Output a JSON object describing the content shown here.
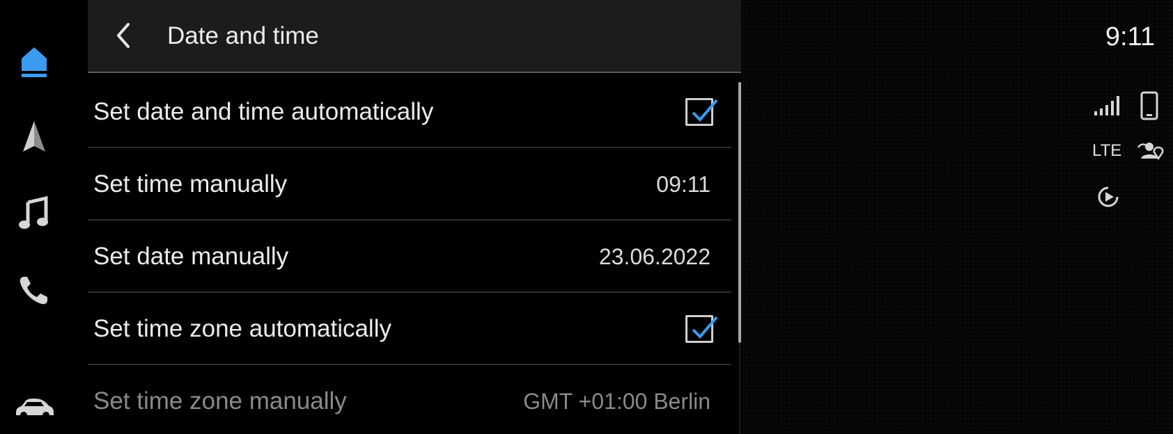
{
  "header": {
    "title": "Date and time"
  },
  "rail": {
    "items": [
      {
        "icon": "home-icon",
        "active": true
      },
      {
        "icon": "navigation-icon",
        "active": false
      },
      {
        "icon": "music-icon",
        "active": false
      },
      {
        "icon": "phone-icon",
        "active": false
      },
      {
        "icon": "car-icon",
        "active": false
      }
    ]
  },
  "settings": {
    "rows": [
      {
        "label": "Set date and time automatically",
        "type": "checkbox",
        "checked": true
      },
      {
        "label": "Set time manually",
        "type": "value",
        "value": "09:11"
      },
      {
        "label": "Set date manually",
        "type": "value",
        "value": "23.06.2022"
      },
      {
        "label": "Set time zone automatically",
        "type": "checkbox",
        "checked": true
      },
      {
        "label": "Set time zone manually",
        "type": "value",
        "value": "GMT +01:00 Berlin",
        "disabled": true
      }
    ]
  },
  "status": {
    "time": "9:11",
    "network": "LTE",
    "icons": [
      "signal-bars-icon",
      "phone-device-icon",
      "location-sharing-icon",
      "media-play-icon"
    ]
  },
  "colors": {
    "accent": "#3a9bf0",
    "header_bg": "#1c1c1c",
    "text": "#ececec",
    "disabled_text": "#8a8a8a"
  }
}
